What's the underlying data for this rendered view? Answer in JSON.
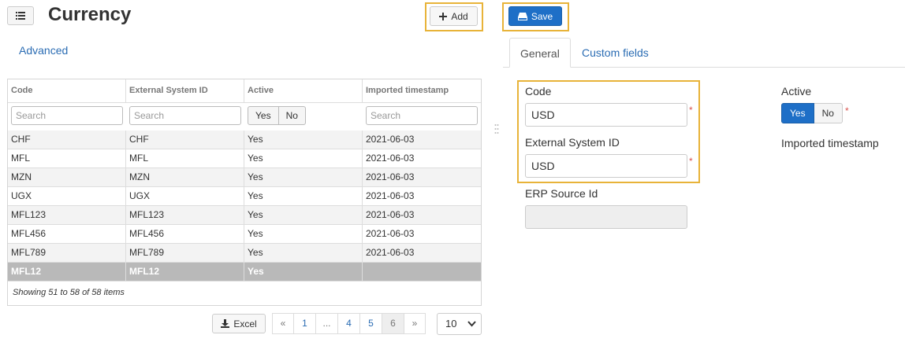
{
  "header": {
    "title": "Currency",
    "add_label": "Add",
    "save_label": "Save"
  },
  "advanced_link": "Advanced",
  "grid": {
    "columns": [
      "Code",
      "External System ID",
      "Active",
      "Imported timestamp"
    ],
    "filters": {
      "code_placeholder": "Search",
      "external_placeholder": "Search",
      "active_yes": "Yes",
      "active_no": "No",
      "timestamp_placeholder": "Search"
    },
    "rows": [
      {
        "code": "CHF",
        "external": "CHF",
        "active": "Yes",
        "timestamp": "2021-06-03"
      },
      {
        "code": "MFL",
        "external": "MFL",
        "active": "Yes",
        "timestamp": "2021-06-03"
      },
      {
        "code": "MZN",
        "external": "MZN",
        "active": "Yes",
        "timestamp": "2021-06-03"
      },
      {
        "code": "UGX",
        "external": "UGX",
        "active": "Yes",
        "timestamp": "2021-06-03"
      },
      {
        "code": "MFL123",
        "external": "MFL123",
        "active": "Yes",
        "timestamp": "2021-06-03"
      },
      {
        "code": "MFL456",
        "external": "MFL456",
        "active": "Yes",
        "timestamp": "2021-06-03"
      },
      {
        "code": "MFL789",
        "external": "MFL789",
        "active": "Yes",
        "timestamp": "2021-06-03"
      },
      {
        "code": "MFL12",
        "external": "MFL12",
        "active": "Yes",
        "timestamp": ""
      }
    ],
    "selected_row": 7,
    "footer": "Showing 51 to 58 of 58 items"
  },
  "pager": {
    "excel_label": "Excel",
    "first": "«",
    "pages": [
      "1",
      "...",
      "4",
      "5",
      "6"
    ],
    "current_page": "6",
    "last": "»",
    "page_size": "10"
  },
  "tabs": {
    "general": "General",
    "custom_fields": "Custom fields"
  },
  "form": {
    "code_label": "Code",
    "code_value": "USD",
    "external_label": "External System ID",
    "external_value": "USD",
    "erp_label": "ERP Source Id",
    "erp_value": "",
    "active_label": "Active",
    "active_yes": "Yes",
    "active_no": "No",
    "required_mark": "*",
    "imported_label": "Imported timestamp"
  },
  "colors": {
    "primary": "#1e6fc7",
    "highlight": "#e8b339",
    "link": "#2a6cb3",
    "selected_row": "#b9b9b9"
  }
}
